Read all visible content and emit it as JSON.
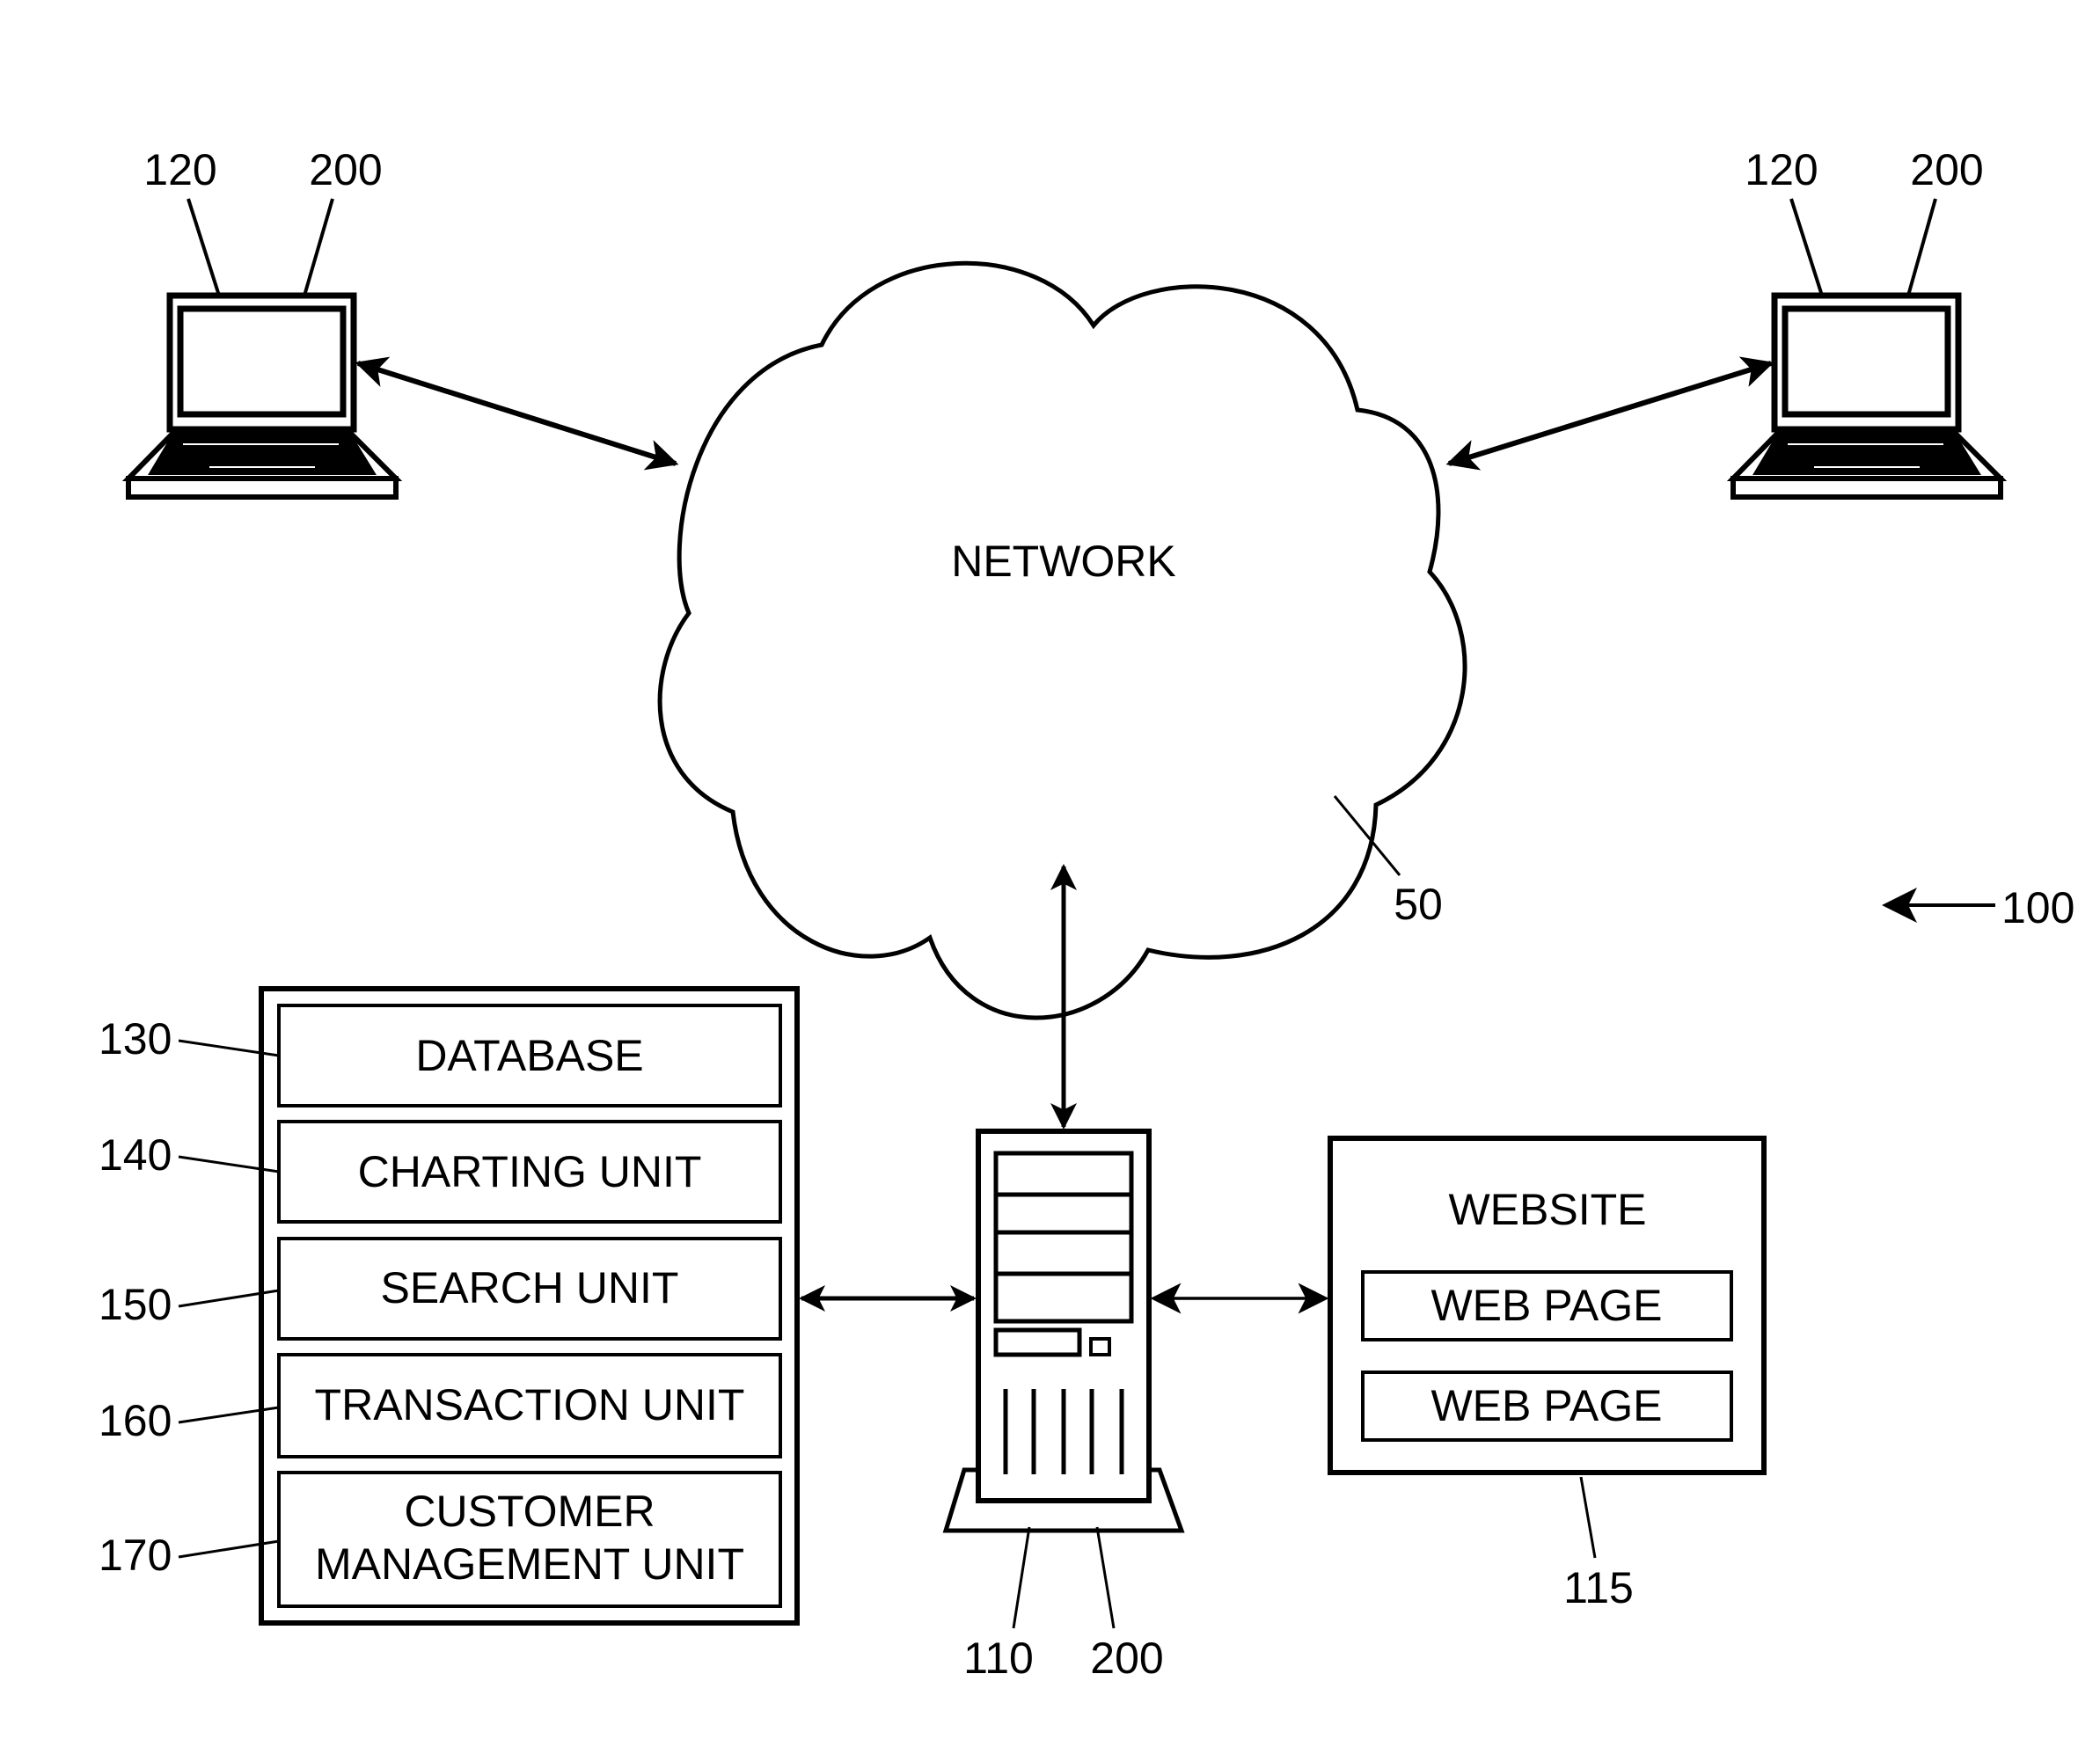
{
  "figure": {
    "reference_number": "100",
    "colors": {
      "line": "#000000",
      "background": "#ffffff"
    }
  },
  "network": {
    "label": "NETWORK",
    "ref": "50",
    "icon": "cloud-icon"
  },
  "clients": [
    {
      "ref_device": "120",
      "ref_module": "200",
      "icon": "laptop-icon"
    },
    {
      "ref_device": "120",
      "ref_module": "200",
      "icon": "laptop-icon"
    }
  ],
  "server": {
    "ref_device": "110",
    "ref_module": "200",
    "icon": "server-tower-icon"
  },
  "system_units": [
    {
      "ref": "130",
      "lines": [
        "DATABASE"
      ]
    },
    {
      "ref": "140",
      "lines": [
        "CHARTING UNIT"
      ]
    },
    {
      "ref": "150",
      "lines": [
        "SEARCH UNIT"
      ]
    },
    {
      "ref": "160",
      "lines": [
        "TRANSACTION UNIT"
      ]
    },
    {
      "ref": "170",
      "lines": [
        "CUSTOMER",
        "MANAGEMENT UNIT"
      ]
    }
  ],
  "website": {
    "ref": "115",
    "title": "WEBSITE",
    "pages": [
      "WEB PAGE",
      "WEB PAGE"
    ]
  }
}
